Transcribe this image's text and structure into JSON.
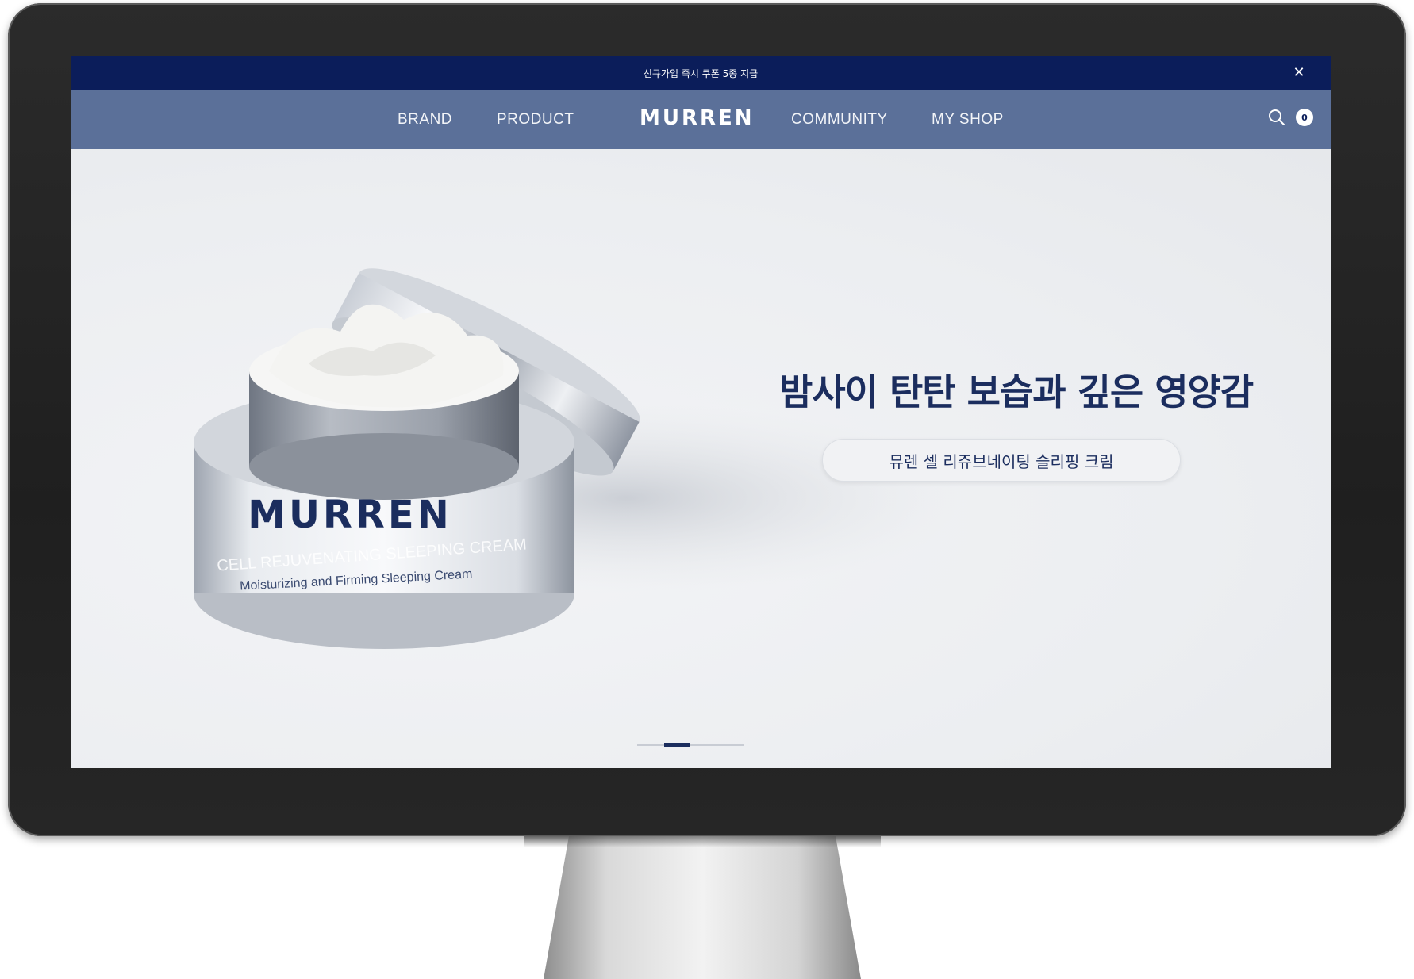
{
  "announcement": {
    "text": "신규가입 즉시 쿠폰 5종 지급"
  },
  "nav": {
    "brand": "BRAND",
    "product": "PRODUCT",
    "logo": "MURREN",
    "community": "COMMUNITY",
    "myshop": "MY SHOP",
    "cart_count": "0"
  },
  "hero": {
    "headline": "밤사이 탄탄 보습과 깊은 영양감",
    "product_name": "뮤렌 셀 리쥬브네이팅 슬리핑 크림",
    "jar_brand": "MURREN",
    "jar_line1": "CELL REJUVENATING SLEEPING CREAM",
    "jar_line2": "Moisturizing and Firming Sleeping Cream"
  },
  "slider": {
    "current": 2,
    "total": 4
  },
  "colors": {
    "navy": "#0b1d5a",
    "nav_blue": "#5b7099",
    "text_navy": "#1b2d5e"
  }
}
